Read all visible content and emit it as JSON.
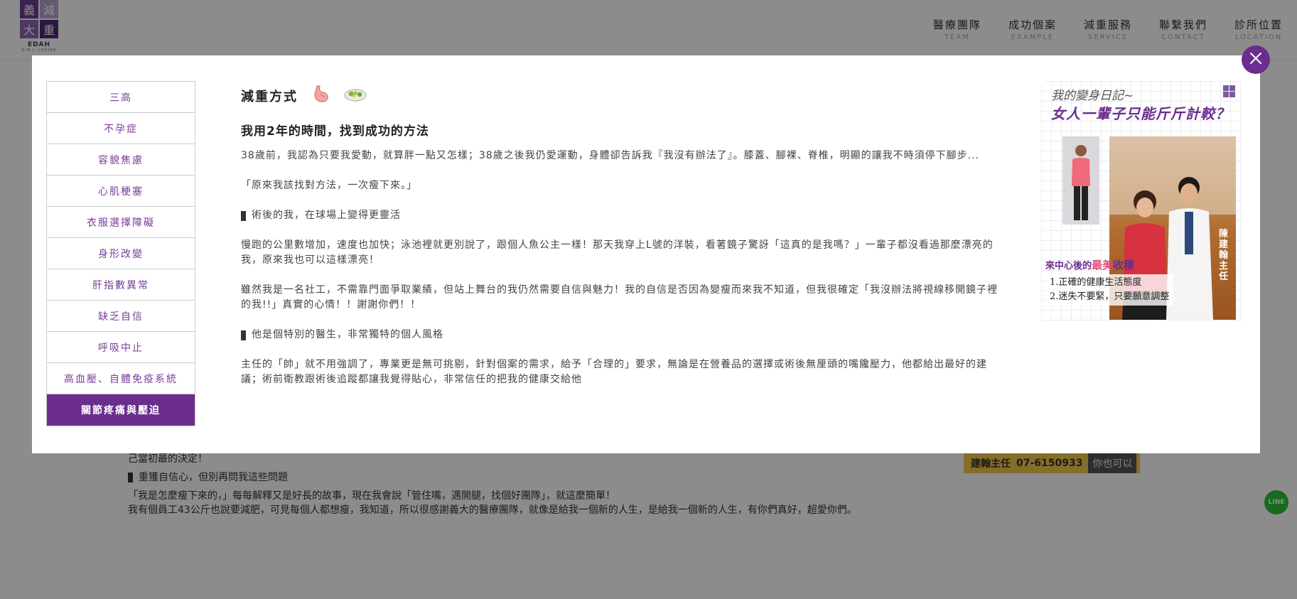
{
  "header": {
    "logo_chars": [
      "義",
      "減",
      "大",
      "重"
    ],
    "logo_text": "EDAH",
    "logo_sub": "B.M.I. CENTER",
    "nav": [
      {
        "zh": "醫療團隊",
        "en": "TEAM"
      },
      {
        "zh": "成功個案",
        "en": "EXAMPLE"
      },
      {
        "zh": "減重服務",
        "en": "SERVICE"
      },
      {
        "zh": "聯繫我們",
        "en": "CONTACT"
      },
      {
        "zh": "診所位置",
        "en": "LOCATION"
      }
    ]
  },
  "background": {
    "line1": "己當初最的決定！",
    "line2": "重獲自信心，但別再問我這些問題",
    "line3": "「我是怎麼瘦下來的，」每每解釋又是好長的故事，現在我會說「管住嘴，邁開腿，找個好團隊」，就這麼簡單！",
    "line4": "我有個員工43公斤也說要減肥，可見每個人都想瘦，我知道，所以很感謝義大的醫療團隊，就像是給我一個新的人生，是給我一個新的人生，有你們真好，超愛你們。",
    "phone_label": "建翰主任",
    "phone_number": "07-6150933",
    "phone_extra": "你也可以",
    "line_label": "LINE"
  },
  "modal": {
    "close_label": "×",
    "side_nav": [
      {
        "label": "三高",
        "active": false
      },
      {
        "label": "不孕症",
        "active": false
      },
      {
        "label": "容貌焦慮",
        "active": false
      },
      {
        "label": "心肌梗塞",
        "active": false
      },
      {
        "label": "衣服選擇障礙",
        "active": false
      },
      {
        "label": "身形改變",
        "active": false
      },
      {
        "label": "肝指數異常",
        "active": false
      },
      {
        "label": "缺乏自信",
        "active": false
      },
      {
        "label": "呼吸中止",
        "active": false
      },
      {
        "label": "高血壓、自體免疫系統",
        "active": false
      },
      {
        "label": "關節疼痛與壓迫",
        "active": true
      }
    ],
    "article": {
      "title": "減重方式",
      "icon_stomach": "stomach-icon",
      "icon_food": "salad-bowl-icon",
      "subtitle": "我用2年的時間，找到成功的方法",
      "p1": "38歲前，我認為只要我愛動，就算胖一點又怎樣；38歲之後我仍愛運動，身體卻告訴我『我沒有辦法了』。膝蓋、腳裸、脊椎，明顯的讓我不時須停下腳步...",
      "p2": "「原來我該找對方法，一次瘦下來。」",
      "h1": "術後的我，在球場上變得更靈活",
      "p3": "慢跑的公里數增加，速度也加快；泳池裡就更別說了，跟個人魚公主一樣！那天我穿上L號的洋裝，看著鏡子驚訝「這真的是我嗎？」一輩子都沒看過那麼漂亮的我，原來我也可以這樣漂亮！",
      "p4": "雖然我是一名社工，不需靠門面爭取業績，但站上舞台的我仍然需要自信與魅力！我的自信是否因為變瘦而來我不知道，但我很確定「我沒辦法將視線移開鏡子裡的我!!」真實的心情！！謝謝你們！！",
      "h2": "他是個特別的醫生，非常獨特的個人風格",
      "p5": "主任的「帥」就不用強調了，專業更是無可挑剔，針對個案的需求，給予「合理的」要求，無論是在營養品的選擇或術後無厘頭的嘴饞壓力，他都給出最好的建議；術前衛教跟術後追蹤都讓我覺得貼心，非常信任的把我的健康交給他"
    },
    "promo": {
      "diary": "我的變身日記~",
      "headline": "女人一輩子只能斤斤計較？",
      "doctor_name": "陳建翰 主任",
      "harvest_prefix": "來中心後的",
      "harvest_highlight": "最美",
      "harvest_suffix": "收穫",
      "list": [
        "1.正確的健康生活態度",
        "2.迷失不要緊，只要願意調整"
      ]
    }
  },
  "colors": {
    "brand": "#6b2d8e",
    "accent_pink": "#e04d7a",
    "line_green": "#2fbf3a"
  }
}
